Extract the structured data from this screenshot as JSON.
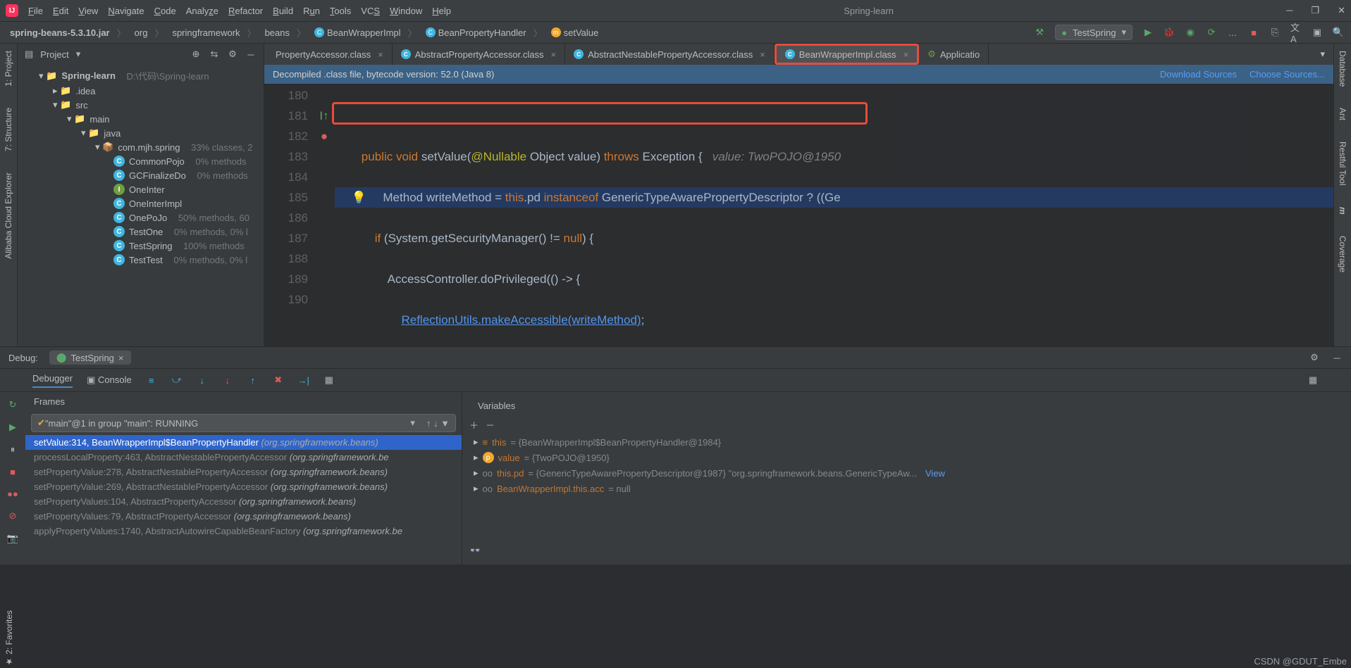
{
  "title": "Spring-learn",
  "menu": [
    "File",
    "Edit",
    "View",
    "Navigate",
    "Code",
    "Analyze",
    "Refactor",
    "Build",
    "Run",
    "Tools",
    "VCS",
    "Window",
    "Help"
  ],
  "breadcrumbs": [
    "spring-beans-5.3.10.jar",
    "org",
    "springframework",
    "beans",
    "BeanWrapperImpl",
    "BeanPropertyHandler",
    "setValue"
  ],
  "run_config": "TestSpring",
  "left_tools": [
    "1: Project",
    "7: Structure",
    "Alibaba Cloud Explorer"
  ],
  "right_tools": [
    "Database",
    "Ant",
    "Restful Tool",
    "Maven",
    "Coverage"
  ],
  "project": {
    "header": "Project",
    "root": {
      "name": "Spring-learn",
      "path": "D:\\代码\\Spring-learn"
    },
    "items": [
      {
        "name": ".idea",
        "type": "folder",
        "indent": 1
      },
      {
        "name": "src",
        "type": "folder",
        "indent": 1,
        "open": true
      },
      {
        "name": "main",
        "type": "folder-blue",
        "indent": 2,
        "open": true
      },
      {
        "name": "java",
        "type": "folder-blue",
        "indent": 3,
        "open": true
      },
      {
        "name": "com.mjh.spring",
        "type": "pkg",
        "indent": 4,
        "hint": "33% classes, 2"
      },
      {
        "name": "CommonPojo",
        "type": "class",
        "indent": 5,
        "hint": "0% methods"
      },
      {
        "name": "GCFinalizeDo",
        "type": "class",
        "indent": 5,
        "hint": "0% methods"
      },
      {
        "name": "OneInter",
        "type": "iface",
        "indent": 5,
        "hint": ""
      },
      {
        "name": "OneInterImpl",
        "type": "class",
        "indent": 5,
        "hint": ""
      },
      {
        "name": "OnePoJo",
        "type": "class",
        "indent": 5,
        "hint": "50% methods, 60"
      },
      {
        "name": "TestOne",
        "type": "class",
        "indent": 5,
        "hint": "0% methods, 0% l"
      },
      {
        "name": "TestSpring",
        "type": "class",
        "indent": 5,
        "hint": "100% methods"
      },
      {
        "name": "TestTest",
        "type": "class",
        "indent": 5,
        "hint": "0% methods, 0% l"
      }
    ]
  },
  "tabs": [
    {
      "label": "PropertyAccessor.class"
    },
    {
      "label": "AbstractPropertyAccessor.class"
    },
    {
      "label": "AbstractNestablePropertyAccessor.class"
    },
    {
      "label": "BeanWrapperImpl.class",
      "active": true,
      "highlight": true
    },
    {
      "label": "Applicatio"
    }
  ],
  "banner": {
    "text": "Decompiled .class file, bytecode version: 52.0 (Java 8)",
    "link1": "Download Sources",
    "link2": "Choose Sources..."
  },
  "gutter": [
    "180",
    "181",
    "182",
    "183",
    "184",
    "185",
    "186",
    "187",
    "188",
    "189",
    "190"
  ],
  "inline_hint": "value: TwoPOJO@1950",
  "debug": {
    "label": "Debug:",
    "tab": "TestSpring",
    "sub_tabs": [
      "Debugger",
      "Console"
    ],
    "frames_title": "Frames",
    "vars_title": "Variables",
    "thread": "\"main\"@1 in group \"main\": RUNNING",
    "frames": [
      {
        "m": "setValue:314, BeanWrapperImpl$BeanPropertyHandler",
        "p": "(org.springframework.beans)",
        "sel": true
      },
      {
        "m": "processLocalProperty:463, AbstractNestablePropertyAccessor",
        "p": "(org.springframework.be"
      },
      {
        "m": "setPropertyValue:278, AbstractNestablePropertyAccessor",
        "p": "(org.springframework.beans)"
      },
      {
        "m": "setPropertyValue:269, AbstractNestablePropertyAccessor",
        "p": "(org.springframework.beans)"
      },
      {
        "m": "setPropertyValues:104, AbstractPropertyAccessor",
        "p": "(org.springframework.beans)"
      },
      {
        "m": "setPropertyValues:79, AbstractPropertyAccessor",
        "p": "(org.springframework.beans)"
      },
      {
        "m": "applyPropertyValues:1740, AbstractAutowireCapableBeanFactory",
        "p": "(org.springframework.be"
      }
    ],
    "vars": [
      {
        "n": "this",
        "v": "= {BeanWrapperImpl$BeanPropertyHandler@1984}",
        "ic": "f"
      },
      {
        "n": "value",
        "v": "= {TwoPOJO@1950}",
        "ic": "p"
      },
      {
        "n": "this.pd",
        "v": "= {GenericTypeAwarePropertyDescriptor@1987} \"org.springframework.beans.GenericTypeAw...",
        "ic": "oo",
        "view": "View"
      },
      {
        "n": "BeanWrapperImpl.this.acc",
        "v": "= null",
        "ic": "oo"
      }
    ]
  },
  "watermark": "CSDN @GDUT_Embe"
}
